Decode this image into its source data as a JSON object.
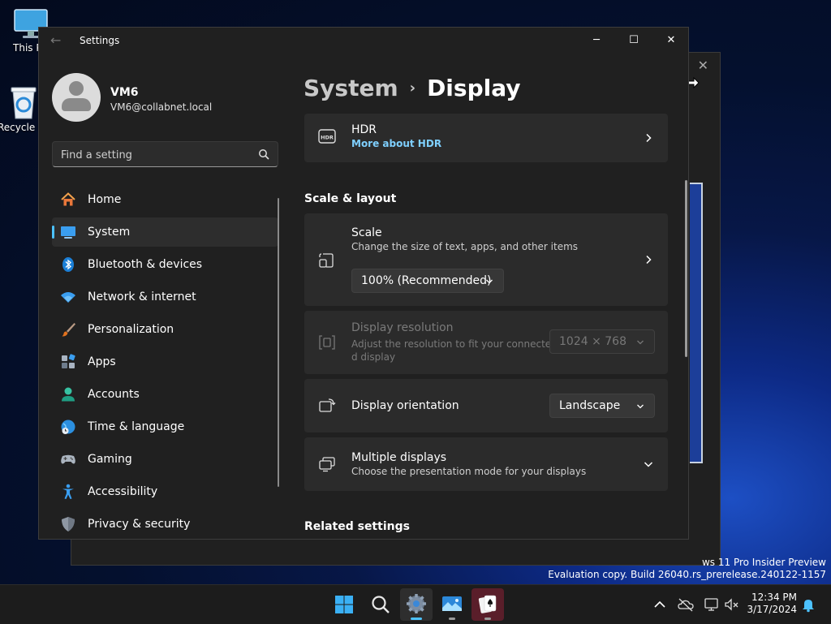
{
  "desktop": {
    "icons": [
      {
        "label": "This PC"
      },
      {
        "label": "Recycle Bin"
      }
    ],
    "watermark": {
      "line1": "ws 11 Pro Insider Preview",
      "line2": "Evaluation copy. Build 26040.rs_prerelease.240122-1157"
    }
  },
  "window": {
    "title": "Settings",
    "controls": {
      "minimize": "─",
      "maximize": "☐",
      "close": "✕"
    }
  },
  "profile": {
    "name": "VM6",
    "email": "VM6@collabnet.local"
  },
  "search": {
    "placeholder": "Find a setting"
  },
  "nav": {
    "items": [
      {
        "label": "Home",
        "icon": "home-icon"
      },
      {
        "label": "System",
        "icon": "system-icon",
        "selected": true
      },
      {
        "label": "Bluetooth & devices",
        "icon": "bluetooth-icon"
      },
      {
        "label": "Network & internet",
        "icon": "wifi-icon"
      },
      {
        "label": "Personalization",
        "icon": "brush-icon"
      },
      {
        "label": "Apps",
        "icon": "apps-icon"
      },
      {
        "label": "Accounts",
        "icon": "accounts-icon"
      },
      {
        "label": "Time & language",
        "icon": "globe-icon"
      },
      {
        "label": "Gaming",
        "icon": "gamepad-icon"
      },
      {
        "label": "Accessibility",
        "icon": "accessibility-icon"
      },
      {
        "label": "Privacy & security",
        "icon": "shield-icon"
      }
    ]
  },
  "breadcrumb": {
    "parent": "System",
    "separator": "›",
    "current": "Display"
  },
  "main": {
    "hdr": {
      "title": "HDR",
      "link": "More about HDR"
    },
    "scale_layout_header": "Scale & layout",
    "scale": {
      "title": "Scale",
      "subtitle": "Change the size of text, apps, and other items",
      "value": "100% (Recommended)"
    },
    "resolution": {
      "title": "Display resolution",
      "subtitle_line1": "Adjust the resolution to fit your connecte",
      "subtitle_line2": "d display",
      "value": "1024 × 768"
    },
    "orientation": {
      "title": "Display orientation",
      "value": "Landscape"
    },
    "multiple": {
      "title": "Multiple displays",
      "subtitle": "Choose the presentation mode for your displays"
    },
    "related_header": "Related settings"
  },
  "taskbar": {
    "apps": [
      "start-icon",
      "search-icon",
      "settings-icon",
      "photos-icon",
      "solitaire-icon"
    ],
    "time": "12:34 PM",
    "date": "3/17/2024"
  },
  "colors": {
    "accent": "#4cc2ff",
    "window_bg": "#202020",
    "card_bg": "#2b2b2b"
  }
}
